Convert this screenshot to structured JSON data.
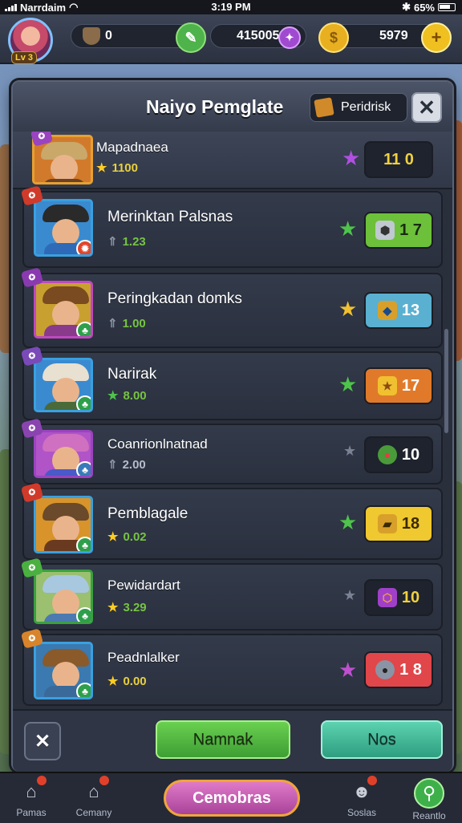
{
  "status_bar": {
    "carrier": "Narrdaim",
    "time": "3:19 PM",
    "battery": "65%"
  },
  "hud": {
    "avatar_level": "Lv 3",
    "currency_a": "0",
    "currency_b": "415005",
    "currency_c": "5979",
    "add_label": "+"
  },
  "modal": {
    "title": "Naiyo Pemglate",
    "header_tab_label": "Peridrisk",
    "close_label": "✕",
    "rows": [
      {
        "name": "Mapadnaea",
        "sub_value": "1100",
        "reward": "11 0",
        "accent": "#ffffff"
      },
      {
        "name": "Merinktan Palsnas",
        "sub_value": "1.23",
        "reward": "1 7",
        "accent": "#76c442"
      },
      {
        "name": "Peringkadan domks",
        "sub_value": "1.00",
        "reward": "13",
        "accent": "#4fa8c8"
      },
      {
        "name": "Narirak",
        "sub_value": "8.00",
        "reward": "17",
        "accent": "#e07a2a"
      },
      {
        "name": "Coanrionlnatnad",
        "sub_value": "2.00",
        "reward": "10",
        "accent": "#ffffff"
      },
      {
        "name": "Pemblagale",
        "sub_value": "0.02",
        "reward": "18",
        "accent": "#f0c830"
      },
      {
        "name": "Pewidardart",
        "sub_value": "3.29",
        "reward": "10",
        "accent": "#ffffff"
      },
      {
        "name": "Peadnlalker",
        "sub_value": "0.00",
        "reward": "1 8",
        "accent": "#e0464a"
      }
    ],
    "footer": {
      "cancel_label": "✕",
      "primary_label": "Namnak",
      "secondary_label": "Nos"
    }
  },
  "bottom_nav": {
    "items": [
      {
        "label": "Pamas"
      },
      {
        "label": "Cemany"
      },
      {
        "label": "Soslas"
      },
      {
        "label": "Reantlo"
      }
    ],
    "center_label": "Cemobras"
  },
  "colors": {
    "primary_button": "#5bc24a",
    "secondary_button": "#4fc6a4",
    "modal_bg": "#2a2f3c"
  }
}
